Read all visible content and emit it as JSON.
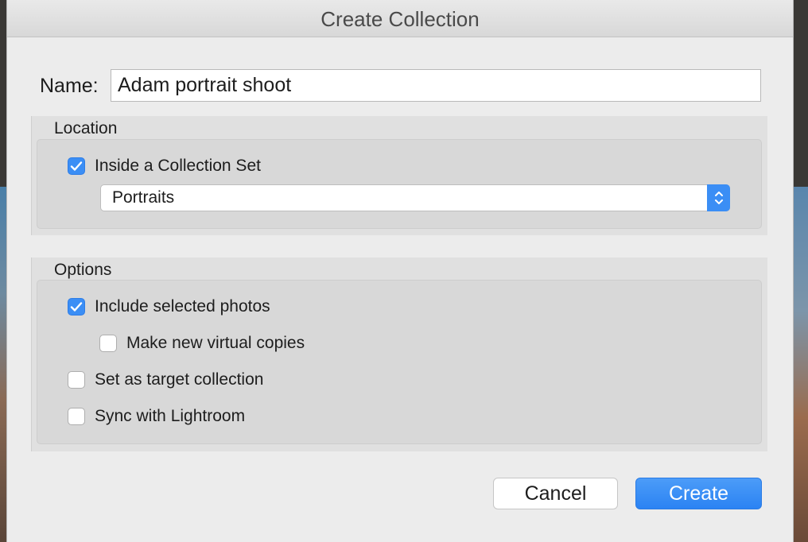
{
  "dialog": {
    "title": "Create Collection"
  },
  "name_field": {
    "label": "Name:",
    "value": "Adam portrait shoot"
  },
  "location": {
    "title": "Location",
    "inside_collection_set": {
      "label": "Inside a Collection Set",
      "checked": true
    },
    "collection_set": {
      "selected": "Portraits",
      "icon": "chevron-up-down-icon"
    }
  },
  "options": {
    "title": "Options",
    "items": [
      {
        "label": "Include selected photos",
        "checked": true
      },
      {
        "label": "Make new virtual copies",
        "checked": false
      },
      {
        "label": "Set as target collection",
        "checked": false
      },
      {
        "label": "Sync with Lightroom",
        "checked": false
      }
    ]
  },
  "buttons": {
    "cancel": "Cancel",
    "create": "Create"
  },
  "colors": {
    "accent": "#3b8ef5",
    "dialog_bg": "#ececec"
  }
}
